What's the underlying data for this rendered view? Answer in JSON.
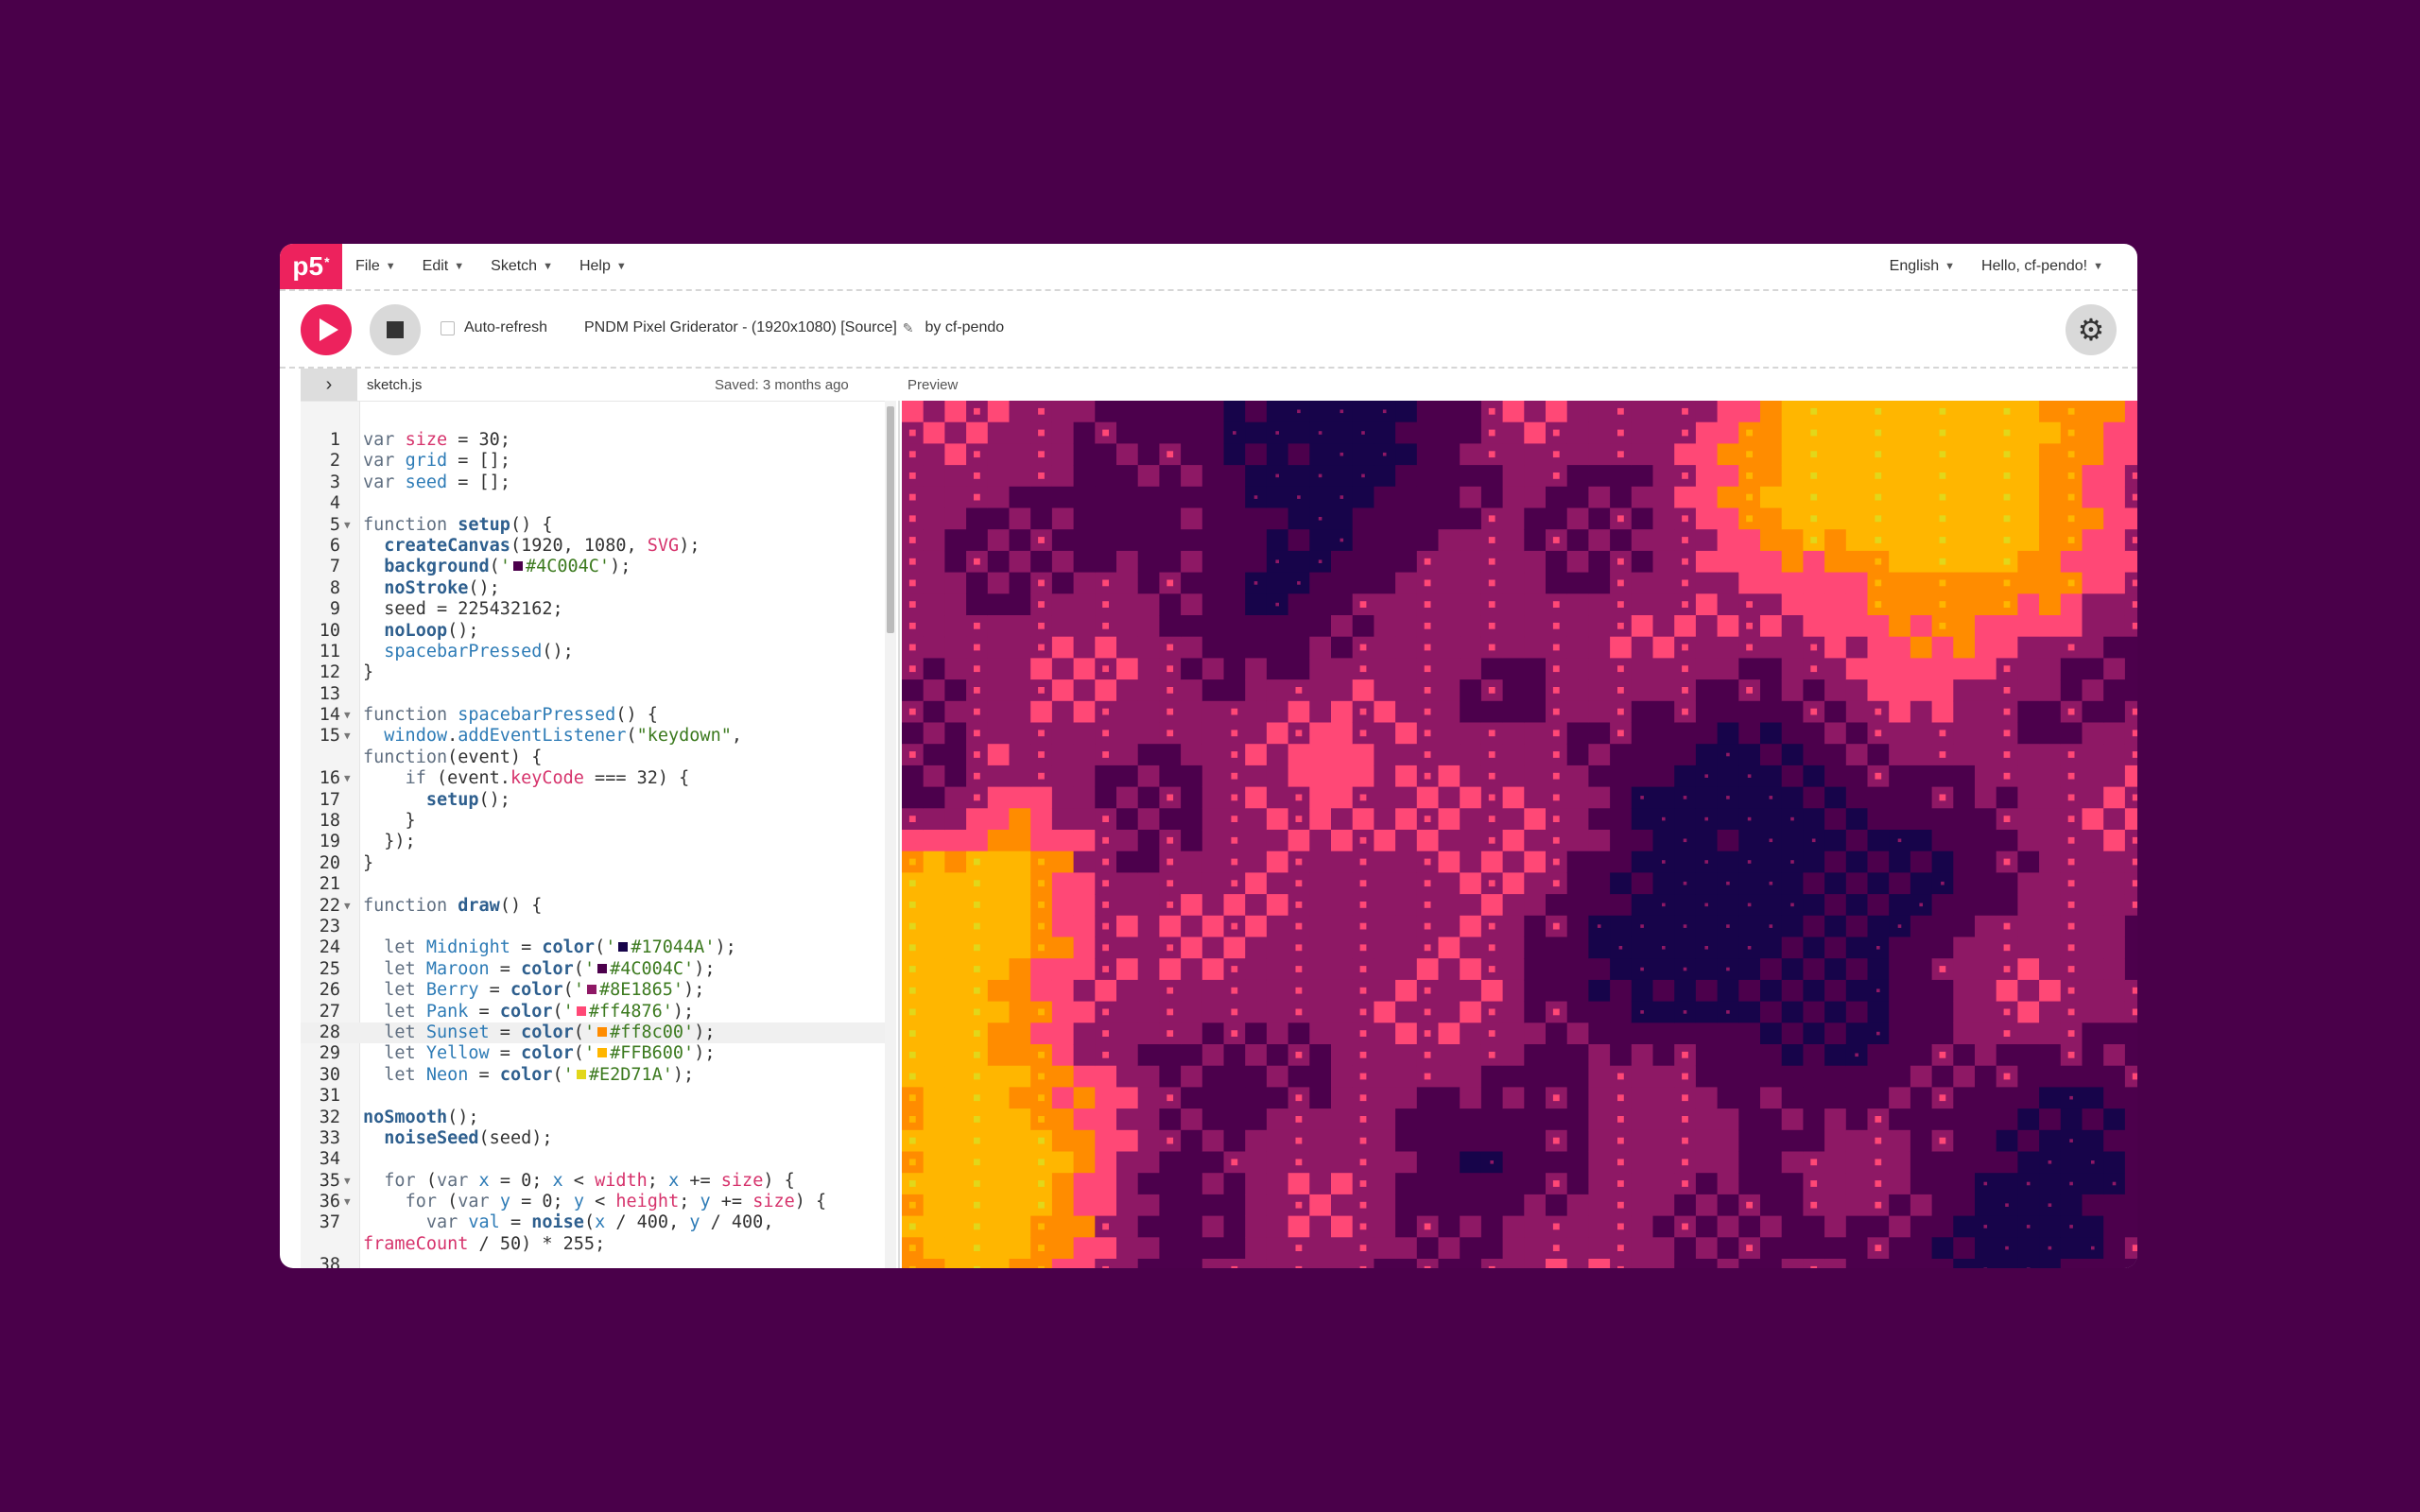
{
  "logo": {
    "text": "p5",
    "sup": "*"
  },
  "menu": {
    "left": [
      "File",
      "Edit",
      "Sketch",
      "Help"
    ],
    "language": "English",
    "user": "Hello, cf-pendo!"
  },
  "toolbar": {
    "auto_refresh_label": "Auto-refresh",
    "sketch_title": "PNDM Pixel Griderator - (1920x1080) [Source]",
    "author": "by cf-pendo"
  },
  "editor": {
    "filename": "sketch.js",
    "saved": "Saved: 3 months ago",
    "preview_label": "Preview",
    "active_line": 28
  },
  "palette": {
    "Midnight": "#17044A",
    "Maroon": "#4C004C",
    "Berry": "#8E1865",
    "Pank": "#ff4876",
    "Sunset": "#ff8c00",
    "Yellow": "#FFB600",
    "Neon": "#E2D71A"
  },
  "code_lines": [
    {
      "n": "1",
      "t": "var size = 30;"
    },
    {
      "n": "2",
      "t": "var grid = [];"
    },
    {
      "n": "3",
      "t": "var seed = [];"
    },
    {
      "n": "4",
      "t": ""
    },
    {
      "n": "5",
      "t": "function setup() {",
      "fold": true
    },
    {
      "n": "6",
      "t": "  createCanvas(1920, 1080, SVG);"
    },
    {
      "n": "7",
      "t": "  background('#4C004C');"
    },
    {
      "n": "8",
      "t": "  noStroke();"
    },
    {
      "n": "9",
      "t": "  seed = 225432162;"
    },
    {
      "n": "10",
      "t": "  noLoop();"
    },
    {
      "n": "11",
      "t": "  spacebarPressed();"
    },
    {
      "n": "12",
      "t": "}"
    },
    {
      "n": "13",
      "t": ""
    },
    {
      "n": "14",
      "t": "function spacebarPressed() {",
      "fold": true
    },
    {
      "n": "15",
      "t": "  window.addEventListener(\"keydown\",",
      "fold": true
    },
    {
      "n": "",
      "t": "function(event) {"
    },
    {
      "n": "16",
      "t": "    if (event.keyCode === 32) {",
      "fold": true
    },
    {
      "n": "17",
      "t": "      setup();"
    },
    {
      "n": "18",
      "t": "    }"
    },
    {
      "n": "19",
      "t": "  });"
    },
    {
      "n": "20",
      "t": "}"
    },
    {
      "n": "21",
      "t": ""
    },
    {
      "n": "22",
      "t": "function draw() {",
      "fold": true
    },
    {
      "n": "23",
      "t": ""
    },
    {
      "n": "24",
      "t": "  let Midnight = color('#17044A');"
    },
    {
      "n": "25",
      "t": "  let Maroon = color('#4C004C');"
    },
    {
      "n": "26",
      "t": "  let Berry = color('#8E1865');"
    },
    {
      "n": "27",
      "t": "  let Pank = color('#ff4876');"
    },
    {
      "n": "28",
      "t": "  let Sunset = color('#ff8c00');"
    },
    {
      "n": "29",
      "t": "  let Yellow = color('#FFB600');"
    },
    {
      "n": "30",
      "t": "  let Neon = color('#E2D71A');"
    },
    {
      "n": "31",
      "t": ""
    },
    {
      "n": "32",
      "t": "noSmooth();"
    },
    {
      "n": "33",
      "t": "  noiseSeed(seed);"
    },
    {
      "n": "34",
      "t": ""
    },
    {
      "n": "35",
      "t": "  for (var x = 0; x < width; x += size) {",
      "fold": true
    },
    {
      "n": "36",
      "t": "    for (var y = 0; y < height; y += size) {",
      "fold": true
    },
    {
      "n": "37",
      "t": "      var val = noise(x / 400, y / 400,"
    },
    {
      "n": "",
      "t": "frameCount / 50) * 255;"
    },
    {
      "n": "38",
      "t": ""
    }
  ]
}
